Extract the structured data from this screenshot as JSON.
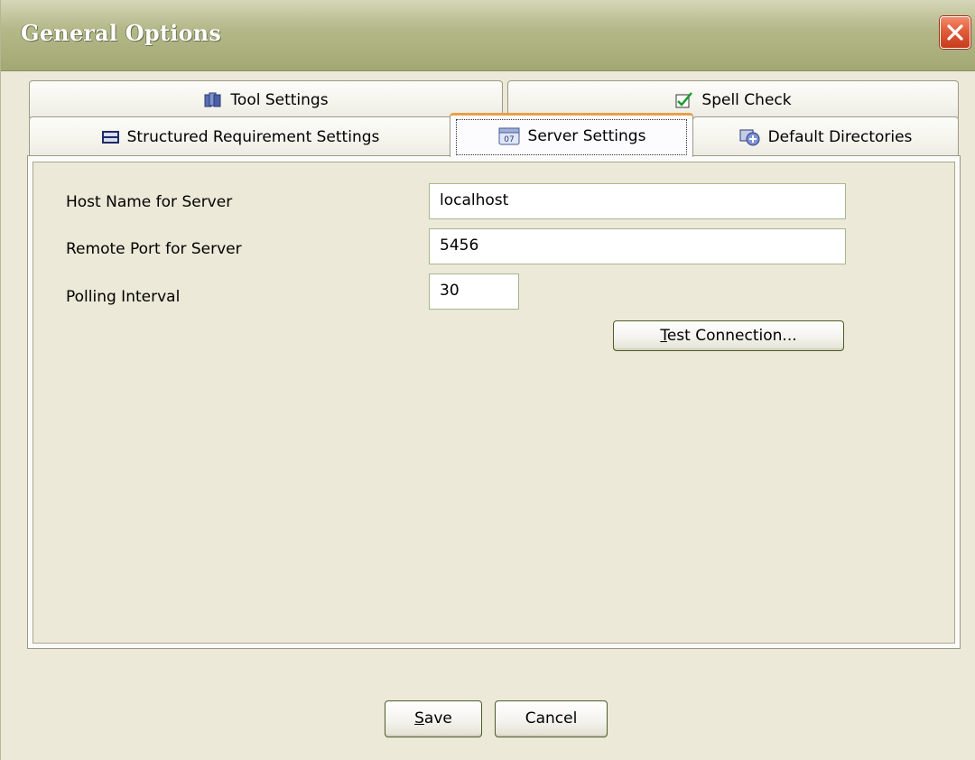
{
  "window": {
    "title": "General Options"
  },
  "tabs": {
    "row1": [
      {
        "label": "Tool Settings",
        "icon": "tool-settings-icon"
      },
      {
        "label": "Spell Check",
        "icon": "spell-check-icon"
      }
    ],
    "row2": [
      {
        "label": "Structured Requirement Settings",
        "icon": "structured-requirement-icon"
      },
      {
        "label": "Server Settings",
        "icon": "server-settings-icon",
        "active": true
      },
      {
        "label": "Default Directories",
        "icon": "default-directories-icon"
      }
    ]
  },
  "server_settings": {
    "host_label": "Host Name for Server",
    "host_value": "localhost",
    "port_label": "Remote Port for Server",
    "port_value": "5456",
    "polling_label": "Polling Interval",
    "polling_value": "30",
    "test_button": {
      "mnemonic": "T",
      "rest": "est Connection..."
    }
  },
  "footer": {
    "save": {
      "mnemonic": "S",
      "rest": "ave"
    },
    "cancel": "Cancel"
  },
  "colors": {
    "title_bar": "#b4b989",
    "close_button": "#e15d3a",
    "active_tab_accent": "#e8a046",
    "dialog_background": "#ece9d8"
  }
}
